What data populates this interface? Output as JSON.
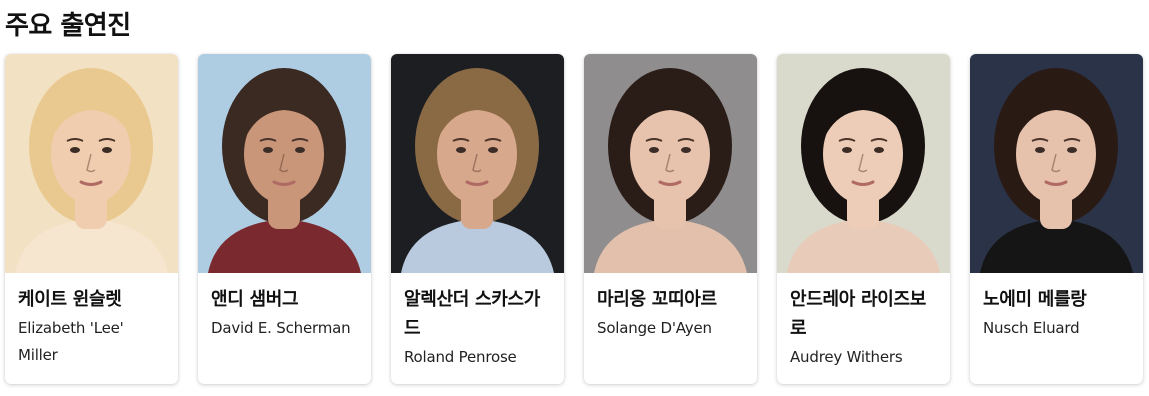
{
  "section": {
    "title": "주요 출연진"
  },
  "cast": [
    {
      "name_ko": "케이트 윈슬렛",
      "name_en": "Elizabeth 'Lee' Miller",
      "bg": "#f3e1c4",
      "hair": "#e9c98f",
      "skin": "#f1cdb0",
      "shirt": "#f6e6cf"
    },
    {
      "name_ko": "앤디 샘버그",
      "name_en": "David E. Scherman",
      "bg": "#aecde3",
      "hair": "#3a2a22",
      "skin": "#c99679",
      "shirt": "#7a2a2e"
    },
    {
      "name_ko": "알렉산더 스카스가드",
      "name_en": "Roland Penrose",
      "bg": "#1c1e22",
      "hair": "#8a6a45",
      "skin": "#d8a88d",
      "shirt": "#b9c9de"
    },
    {
      "name_ko": "마리옹 꼬띠아르",
      "name_en": "Solange D'Ayen",
      "bg": "#8f8d8d",
      "hair": "#2a1d18",
      "skin": "#e7c2ad",
      "shirt": "#e2c0ac"
    },
    {
      "name_ko": "안드레아 라이즈보로",
      "name_en": "Audrey Withers",
      "bg": "#d9d9cc",
      "hair": "#17120f",
      "skin": "#edcdb8",
      "shirt": "#e8cbb9"
    },
    {
      "name_ko": "노에미 메를랑",
      "name_en": "Nusch Eluard",
      "bg": "#2b3348",
      "hair": "#2a1a14",
      "skin": "#e6c1ac",
      "shirt": "#151515"
    }
  ]
}
